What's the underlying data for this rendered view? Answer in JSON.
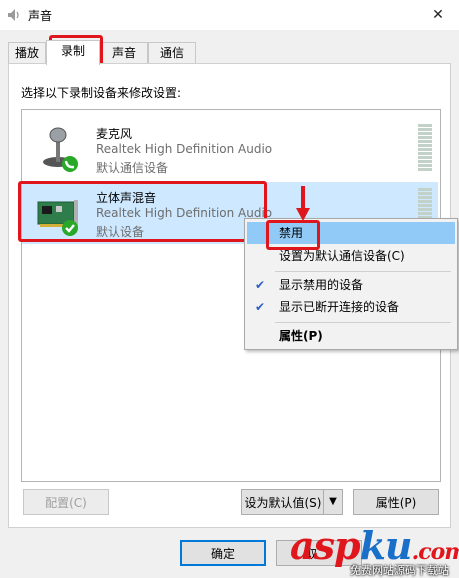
{
  "window": {
    "title": "声音",
    "close_glyph": "✕"
  },
  "tabs": [
    {
      "label": "播放",
      "active": false
    },
    {
      "label": "录制",
      "active": true
    },
    {
      "label": "声音",
      "active": false
    },
    {
      "label": "通信",
      "active": false
    }
  ],
  "instruction": "选择以下录制设备来修改设置:",
  "devices": [
    {
      "name": "麦克风",
      "description": "Realtek High Definition Audio",
      "status": "默认通信设备",
      "icon": "microphone-icon",
      "badge": "phone-badge-icon",
      "selected": false
    },
    {
      "name": "立体声混音",
      "description": "Realtek High Definition Audio",
      "status": "默认设备",
      "icon": "sound-card-icon",
      "badge": "check-badge-icon",
      "selected": true
    }
  ],
  "context_menu": {
    "items": [
      {
        "label": "禁用",
        "checked": false,
        "hover": true,
        "bold": false
      },
      {
        "label": "设置为默认通信设备(C)",
        "checked": false,
        "hover": false,
        "bold": false
      },
      {
        "label": "显示禁用的设备",
        "checked": true,
        "hover": false,
        "bold": false
      },
      {
        "label": "显示已断开连接的设备",
        "checked": true,
        "hover": false,
        "bold": false
      },
      {
        "label": "属性(P)",
        "checked": false,
        "hover": false,
        "bold": true
      }
    ],
    "check_glyph": "✔"
  },
  "buttons": {
    "configure": "配置(C)",
    "set_default": "设为默认值(S)",
    "set_default_arrow": "▼",
    "properties": "属性(P)",
    "ok": "确定",
    "cancel": "取"
  },
  "watermark": {
    "text": "aspku",
    "sub": "免费网站源码下载站"
  },
  "colors": {
    "annotation_red": "#e0161d",
    "selection_blue": "#cde8ff",
    "menu_hover": "#91c9f7",
    "check_green": "#2aa82a"
  }
}
